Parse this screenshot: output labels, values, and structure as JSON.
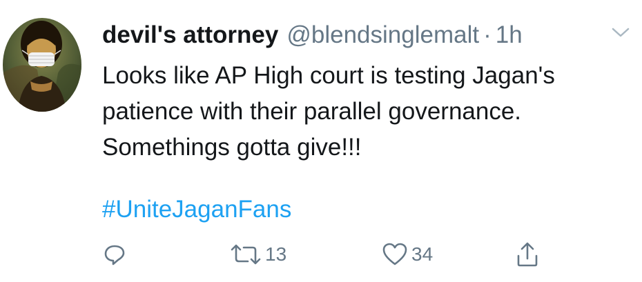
{
  "tweet": {
    "display_name": "devil's attorney",
    "handle": "@blendsinglemalt",
    "separator": "·",
    "time": "1h",
    "text": "Looks like AP High court is testing Jagan's\npatience with their parallel governance.\nSomethings gotta give!!!",
    "hashtag": "#UniteJaganFans"
  },
  "actions": {
    "reply": {
      "icon": "reply-icon"
    },
    "retweet": {
      "icon": "retweet-icon",
      "count": "13"
    },
    "like": {
      "icon": "heart-icon",
      "count": "34"
    },
    "share": {
      "icon": "share-icon"
    }
  },
  "colors": {
    "text": "#14171a",
    "muted": "#657786",
    "link": "#1da1f2",
    "background": "#ffffff"
  }
}
